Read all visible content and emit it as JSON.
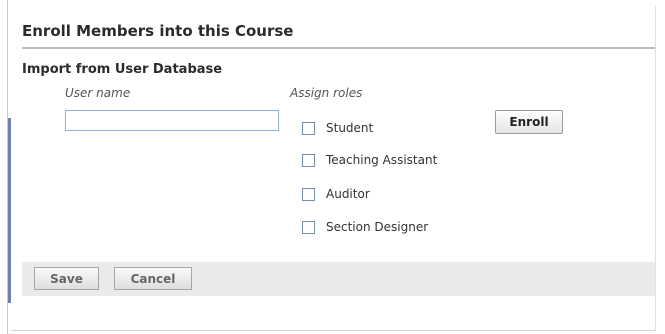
{
  "panel": {
    "title": "Enroll Members into this Course"
  },
  "import_section": {
    "title": "Import from User Database",
    "username_label": "User name",
    "username_value": "",
    "roles_label": "Assign roles",
    "roles": [
      {
        "label": "Student",
        "checked": false
      },
      {
        "label": "Teaching Assistant",
        "checked": false
      },
      {
        "label": "Auditor",
        "checked": false
      },
      {
        "label": "Section Designer",
        "checked": false
      }
    ],
    "enroll_label": "Enroll"
  },
  "footer": {
    "save_label": "Save",
    "cancel_label": "Cancel"
  },
  "colors": {
    "accent_bar": "#6f7fb5",
    "input_border": "#8fb3d6",
    "footer_bg": "#eaeaea"
  }
}
